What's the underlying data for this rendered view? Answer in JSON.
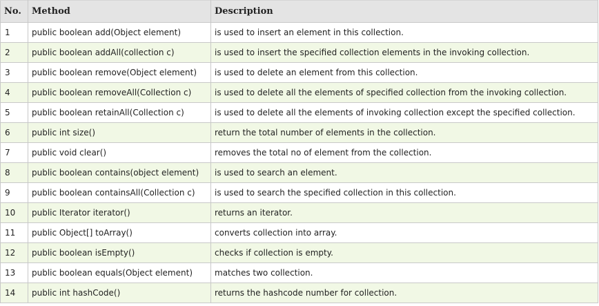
{
  "table": {
    "headers": {
      "no": "No.",
      "method": "Method",
      "description": "Description"
    },
    "rows": [
      {
        "no": "1",
        "method": "public boolean add(Object element)",
        "description": "is used to insert an element in this collection."
      },
      {
        "no": "2",
        "method": "public boolean addAll(collection c)",
        "description": "is used to insert the specified collection elements in the invoking collection."
      },
      {
        "no": "3",
        "method": "public boolean remove(Object element)",
        "description": "is used to delete an element from this collection."
      },
      {
        "no": "4",
        "method": "public boolean removeAll(Collection c)",
        "description": "is used to delete all the elements of specified collection from the invoking collection."
      },
      {
        "no": "5",
        "method": "public boolean retainAll(Collection c)",
        "description": "is used to delete all the elements of invoking collection except the specified collection."
      },
      {
        "no": "6",
        "method": "public int size()",
        "description": "return the total number of elements in the collection."
      },
      {
        "no": "7",
        "method": "public void clear()",
        "description": "removes the total no of element from the collection."
      },
      {
        "no": "8",
        "method": "public boolean contains(object element)",
        "description": "is used to search an element."
      },
      {
        "no": "9",
        "method": "public boolean containsAll(Collection c)",
        "description": "is used to search the specified collection in this collection."
      },
      {
        "no": "10",
        "method": "public Iterator iterator()",
        "description": "returns an iterator."
      },
      {
        "no": "11",
        "method": "public Object[] toArray()",
        "description": "converts collection into array."
      },
      {
        "no": "12",
        "method": "public boolean isEmpty()",
        "description": "checks if collection is empty."
      },
      {
        "no": "13",
        "method": "public boolean equals(Object element)",
        "description": "matches two collection."
      },
      {
        "no": "14",
        "method": "public int hashCode()",
        "description": "returns the hashcode number for collection."
      }
    ]
  },
  "colors": {
    "header_bg": "#e4e4e4",
    "row_odd_bg": "#ffffff",
    "row_even_bg": "#f1f8e5",
    "border": "#c8c8c8",
    "text": "#222222"
  }
}
